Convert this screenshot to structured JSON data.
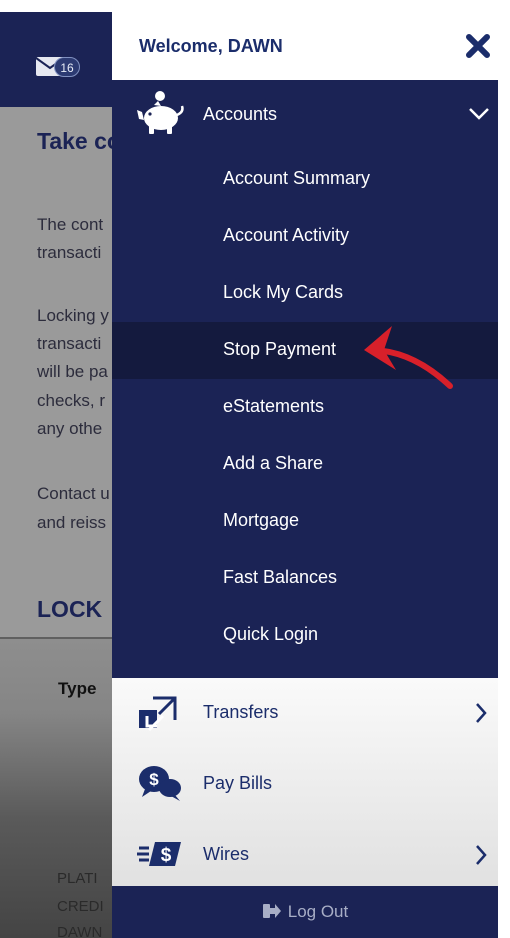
{
  "background": {
    "mail_badge_count": "16",
    "heading": "Take co",
    "paragraphs": [
      [
        "The cont",
        "transacti"
      ],
      [
        "Locking y",
        "transacti",
        "will be pa",
        "checks, r",
        "any othe"
      ],
      [
        "Contact u",
        "and reiss"
      ]
    ],
    "section_heading": "LOCK",
    "column_header": "Type",
    "row_text": [
      "PLATI",
      "CREDI",
      "DAWN"
    ]
  },
  "drawer": {
    "welcome": "Welcome, DAWN",
    "accounts": {
      "label": "Accounts",
      "icon": "piggy-bank-icon",
      "expanded": true,
      "items": [
        {
          "label": "Account Summary"
        },
        {
          "label": "Account Activity"
        },
        {
          "label": "Lock My Cards"
        },
        {
          "label": "Stop Payment",
          "highlighted": true
        },
        {
          "label": "eStatements"
        },
        {
          "label": "Add a Share"
        },
        {
          "label": "Mortgage"
        },
        {
          "label": "Fast Balances"
        },
        {
          "label": "Quick Login"
        }
      ]
    },
    "menu_items": [
      {
        "label": "Transfers",
        "icon": "transfer-arrows-icon",
        "has_chevron": true
      },
      {
        "label": "Pay Bills",
        "icon": "pay-bills-icon",
        "has_chevron": false
      },
      {
        "label": "Wires",
        "icon": "wire-money-icon",
        "has_chevron": true
      }
    ],
    "logout_label": "Log Out"
  },
  "colors": {
    "navy": "#1b2355",
    "brand_text": "#1b2d6b",
    "highlight_row": "#141a3e",
    "annotation_arrow": "#d8202a"
  }
}
